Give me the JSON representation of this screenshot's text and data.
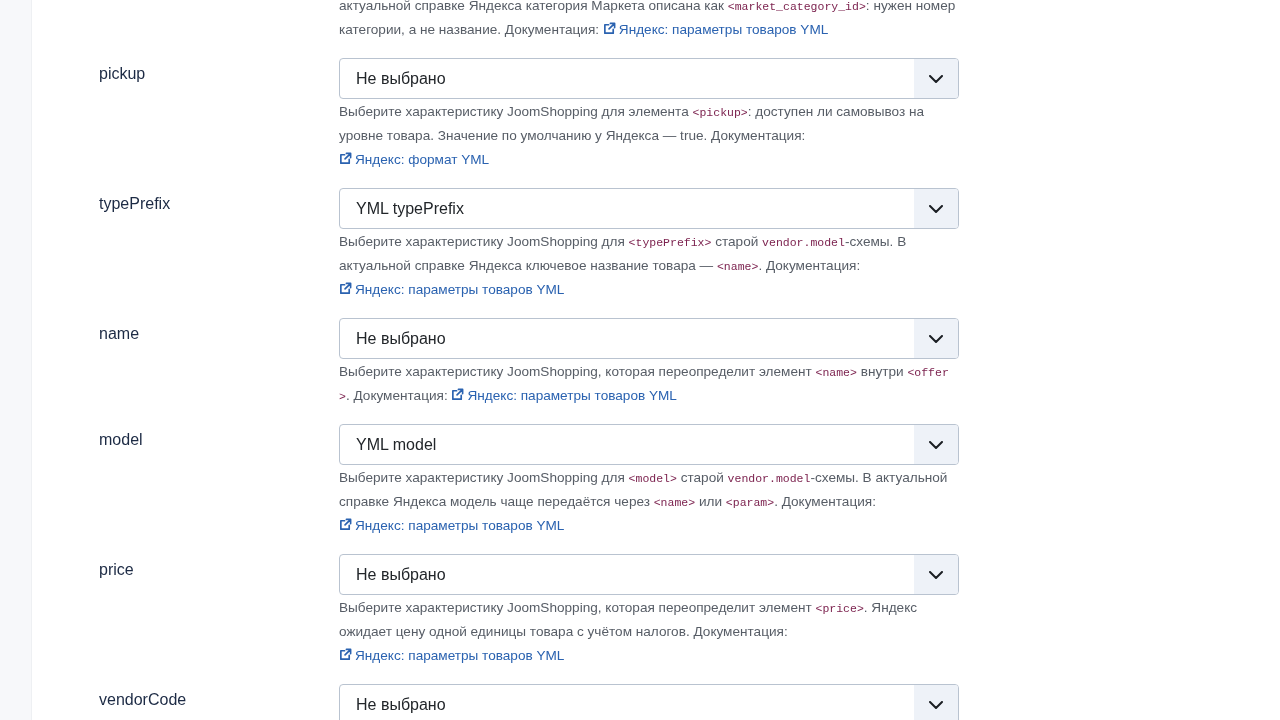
{
  "partial_description": [
    {
      "kind": "text",
      "text": "актуальной справке Яндекса категория Маркета описана как "
    },
    {
      "kind": "code",
      "text": "<market_category_id>"
    },
    {
      "kind": "text",
      "text": ": нужен номер категории, а не название. Документация: "
    },
    {
      "kind": "link",
      "text": "Яндекс: параметры товаров YML"
    }
  ],
  "fields": [
    {
      "label": "pickup",
      "value": "Не выбрано",
      "description": [
        {
          "kind": "text",
          "text": "Выберите характеристику JoomShopping для элемента "
        },
        {
          "kind": "code",
          "text": "<pickup>"
        },
        {
          "kind": "text",
          "text": ": доступен ли самовывоз на уровне товара. Значение по умолчанию у Яндекса — true. Документация: "
        },
        {
          "kind": "link",
          "text": "Яндекс: формат YML"
        }
      ]
    },
    {
      "label": "typePrefix",
      "value": "YML typePrefix",
      "description": [
        {
          "kind": "text",
          "text": "Выберите характеристику JoomShopping для "
        },
        {
          "kind": "code",
          "text": "<typePrefix>"
        },
        {
          "kind": "text",
          "text": " старой "
        },
        {
          "kind": "code",
          "text": "vendor.model"
        },
        {
          "kind": "text",
          "text": "-схемы. В актуальной справке Яндекса ключевое название товара — "
        },
        {
          "kind": "code",
          "text": "<name>"
        },
        {
          "kind": "text",
          "text": ". Документация: "
        },
        {
          "kind": "link",
          "text": "Яндекс: параметры товаров YML"
        }
      ]
    },
    {
      "label": "name",
      "value": "Не выбрано",
      "description": [
        {
          "kind": "text",
          "text": "Выберите характеристику JoomShopping, которая переопределит элемент "
        },
        {
          "kind": "code",
          "text": "<name>"
        },
        {
          "kind": "text",
          "text": " внутри "
        },
        {
          "kind": "code",
          "text": "<offer>"
        },
        {
          "kind": "text",
          "text": ". Документация: "
        },
        {
          "kind": "link",
          "text": "Яндекс: параметры товаров YML"
        }
      ]
    },
    {
      "label": "model",
      "value": "YML model",
      "description": [
        {
          "kind": "text",
          "text": "Выберите характеристику JoomShopping для "
        },
        {
          "kind": "code",
          "text": "<model>"
        },
        {
          "kind": "text",
          "text": " старой "
        },
        {
          "kind": "code",
          "text": "vendor.model"
        },
        {
          "kind": "text",
          "text": "-схемы. В актуальной справке Яндекса модель чаще передаётся через "
        },
        {
          "kind": "code",
          "text": "<name>"
        },
        {
          "kind": "text",
          "text": " или "
        },
        {
          "kind": "code",
          "text": "<param>"
        },
        {
          "kind": "text",
          "text": ". Документация: "
        },
        {
          "kind": "link",
          "text": "Яндекс: параметры товаров YML"
        }
      ]
    },
    {
      "label": "price",
      "value": "Не выбрано",
      "description": [
        {
          "kind": "text",
          "text": "Выберите характеристику JoomShopping, которая переопределит элемент "
        },
        {
          "kind": "code",
          "text": "<price>"
        },
        {
          "kind": "text",
          "text": ". Яндекс ожидает цену одной единицы товара с учётом налогов. Документация: "
        },
        {
          "kind": "link",
          "text": "Яндекс: параметры товаров YML"
        }
      ]
    },
    {
      "label": "vendorCode",
      "value": "Не выбрано"
    }
  ]
}
